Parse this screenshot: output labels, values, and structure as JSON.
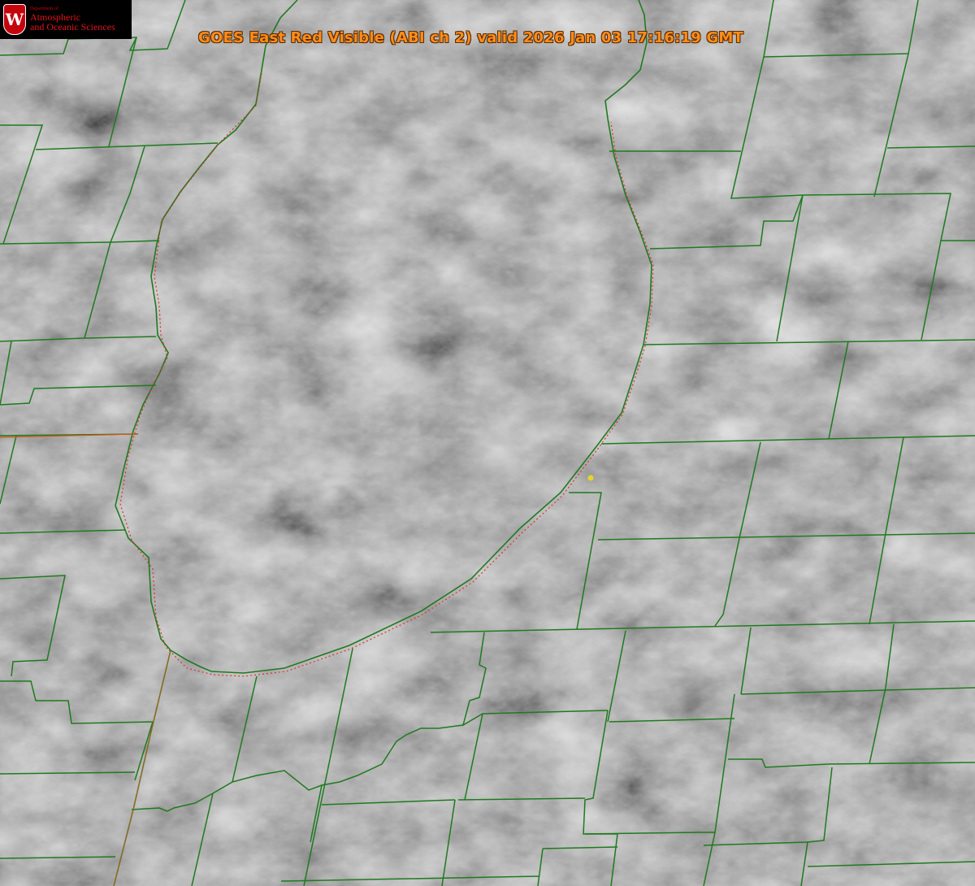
{
  "image": {
    "title": "GOES East Red Visible (ABI ch 2) valid 2026 Jan 03 17:16:19 GMT",
    "title_color": "#ff8c1a"
  },
  "logo": {
    "department_line": "Department of",
    "line1": "Atmospheric",
    "line2": "and Oceanic Sciences",
    "crest_letter": "W",
    "crest_color": "#c5050c"
  },
  "map_style": {
    "boundary_color": "#1f7a1f",
    "shoreline_dotted_color": "#e0302a",
    "marker_color": "#e6d42a",
    "cloud_base_color": "#8a8a8a"
  }
}
